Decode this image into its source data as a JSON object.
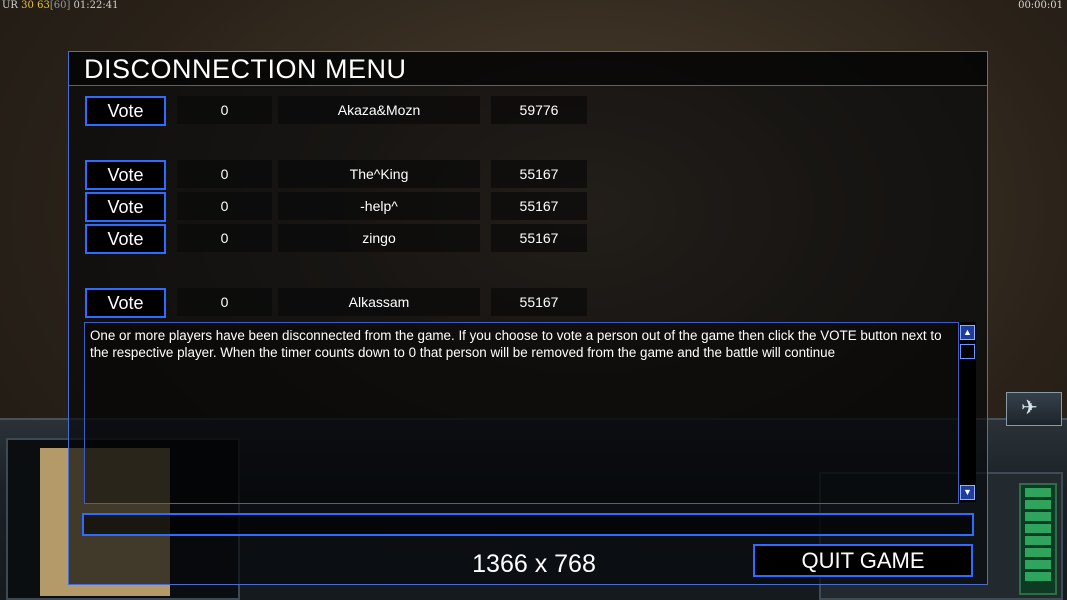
{
  "hud": {
    "top_left_prefix": "UR",
    "top_left_fps": "30",
    "top_left_value": "63",
    "top_left_bracket": "[60]",
    "top_left_time": "01:22:41",
    "top_right_time": "00:00:01",
    "satellite_icon": "satellite-icon"
  },
  "dialog": {
    "title": "DISCONNECTION MENU",
    "rows": [
      {
        "vote_label": "Vote",
        "count": "0",
        "name": "Akaza&Mozn",
        "ping": "59776"
      },
      {
        "vote_label": "Vote",
        "count": "0",
        "name": "The^King",
        "ping": "55167"
      },
      {
        "vote_label": "Vote",
        "count": "0",
        "name": "-help^",
        "ping": "55167"
      },
      {
        "vote_label": "Vote",
        "count": "0",
        "name": "zingo",
        "ping": "55167"
      },
      {
        "vote_label": "Vote",
        "count": "0",
        "name": "Alkassam",
        "ping": "55167"
      }
    ],
    "message": "One or more players have been disconnected from the game. If you choose to vote a person out of the game then click the VOTE button next to the respective player. When the timer counts down to 0 that person will be removed from the game and the battle will continue",
    "chat_input_value": "",
    "resolution_label": "1366 x 768",
    "quit_label": "QUIT GAME"
  },
  "colors": {
    "accent_border": "#2f6bff",
    "panel_bg": "#000000"
  }
}
